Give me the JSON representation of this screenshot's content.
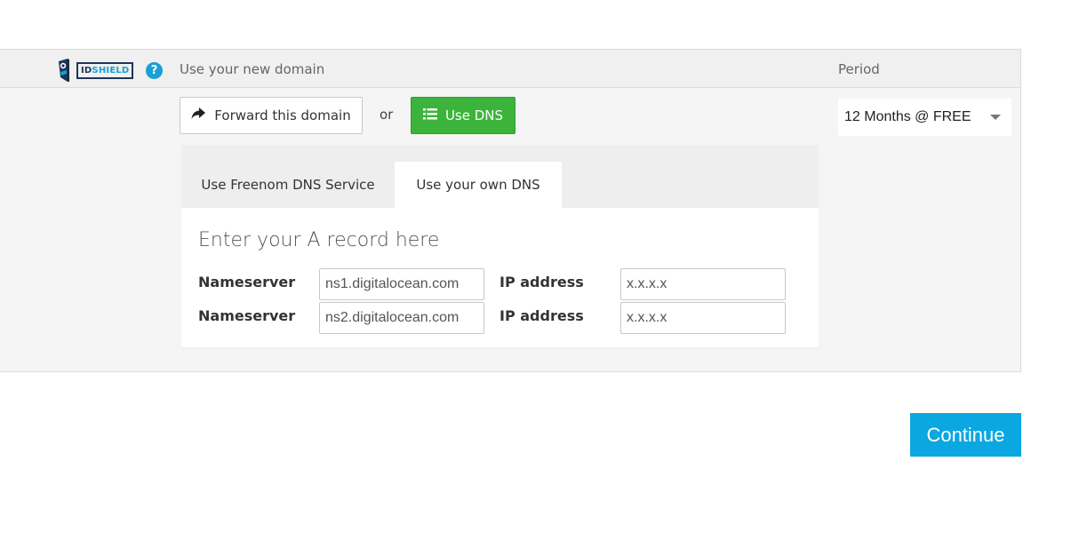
{
  "brand": {
    "logo_text_id": "ID",
    "logo_text_shield": "SHIELD",
    "help_icon": "question-circle-icon"
  },
  "header": {
    "title": "Use your new domain",
    "period_label": "Period"
  },
  "actions": {
    "forward_label": "Forward this domain",
    "forward_icon": "share-arrow-icon",
    "or_text": "or",
    "dns_label": "Use DNS",
    "dns_icon": "list-icon",
    "dns_color": "#3cb43c"
  },
  "period_select": {
    "value": "12 Months @ FREE"
  },
  "dns_tabs": [
    {
      "label": "Use Freenom DNS Service",
      "active": false
    },
    {
      "label": "Use your own DNS",
      "active": true
    }
  ],
  "record_form": {
    "title": "Enter your A record here",
    "rows": [
      {
        "ns_label": "Nameserver",
        "ns_value": "ns1.digitalocean.com",
        "ip_label": "IP address",
        "ip_value": "x.x.x.x"
      },
      {
        "ns_label": "Nameserver",
        "ns_value": "ns2.digitalocean.com",
        "ip_label": "IP address",
        "ip_value": "x.x.x.x"
      }
    ]
  },
  "footer": {
    "continue_label": "Continue",
    "continue_color": "#0ba7e0"
  }
}
